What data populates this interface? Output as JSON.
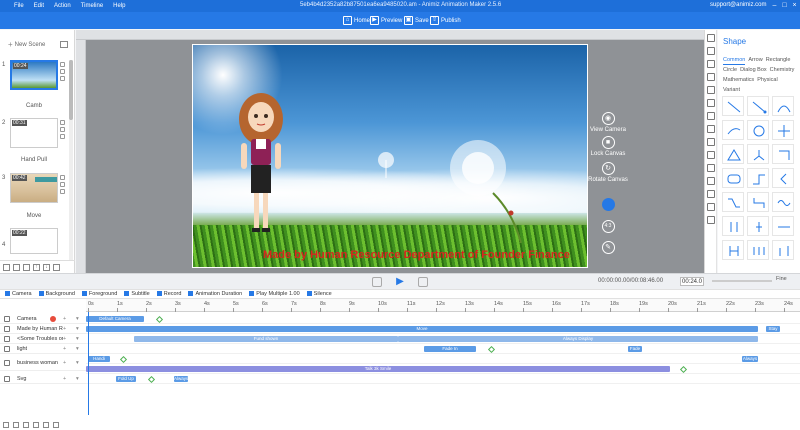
{
  "menu": [
    "File",
    "Edit",
    "Action",
    "Timeline",
    "Help"
  ],
  "doc_title": "5eb4b4d2352a82b87501ea6ea9485020.am - Animiz Animation Maker 2.5.6",
  "user_email": "support@animiz.com",
  "toolbar": {
    "home": "Home",
    "preview": "Preview",
    "save": "Save",
    "publish": "Publish"
  },
  "scene_panel": {
    "new_scene": "New Scene",
    "scenes": [
      {
        "num": "00:24",
        "name": "Camb"
      },
      {
        "num": "00:31",
        "name": "Hand Pull"
      },
      {
        "num": "00:42",
        "name": "Move"
      },
      {
        "num": "00:22",
        "name": ""
      }
    ],
    "side_nums": [
      "1",
      "2",
      "3",
      "4"
    ]
  },
  "stage": {
    "caption": "Made by Human Resource Department of Founder Finance"
  },
  "camera_tools": {
    "view": "View Camera",
    "lock": "Lock Canvas",
    "rotate": "Rotate Canvas",
    "ratio": "4:3"
  },
  "shape_panel": {
    "title": "Shape",
    "categories": [
      "Common",
      "Arrow",
      "Rectangle",
      "Circle",
      "Dialog Box",
      "Chemistry",
      "Mathematics",
      "Physical",
      "Variant"
    ],
    "active_category": "Common"
  },
  "transport": {
    "time": "00:00:00.00/00:08:46.00",
    "total": "00:24.0",
    "zoom": "Fine"
  },
  "layer_toolbar": [
    "Camera",
    "Background",
    "Foreground",
    "Subtitle",
    "Record",
    "Animation Duration",
    "Play Multiple 1.00",
    "Silence"
  ],
  "timeline": {
    "ticks": [
      "0s",
      "1s",
      "2s",
      "3s",
      "4s",
      "5s",
      "6s",
      "7s",
      "8s",
      "9s",
      "10s",
      "11s",
      "12s",
      "13s",
      "14s",
      "15s",
      "16s",
      "17s",
      "18s",
      "19s",
      "20s",
      "21s",
      "22s",
      "23s",
      "24s"
    ],
    "layers": [
      {
        "name": "Camera",
        "a": "+",
        "b": "▾"
      },
      {
        "name": "Made by Human Re",
        "a": "+",
        "b": "▾"
      },
      {
        "name": "<Some Troubles on",
        "a": "+",
        "b": "▾"
      },
      {
        "name": "light",
        "a": "+",
        "b": "▾"
      },
      {
        "name": "business woman",
        "a": "+",
        "b": "▾"
      },
      {
        "name": "Svg",
        "a": "+",
        "b": "▾"
      }
    ],
    "bars": {
      "camera": "Default Camera",
      "made_by": "Move",
      "made_by_end": "Stay",
      "troubles": "Fund shown",
      "troubles_2": "Always Display",
      "light": "Fade In",
      "light_end": "Fade",
      "woman_1": "Handi",
      "woman_2": "Talk 3k Smile",
      "woman_end": "Always",
      "svg_1": "Fold Up",
      "svg_2": "Always"
    }
  },
  "colors": {
    "accent": "#2679e6",
    "bar_blue": "#5b9be6",
    "bar_purple": "#8c8fe0",
    "bar_light": "#8fb8ea"
  }
}
